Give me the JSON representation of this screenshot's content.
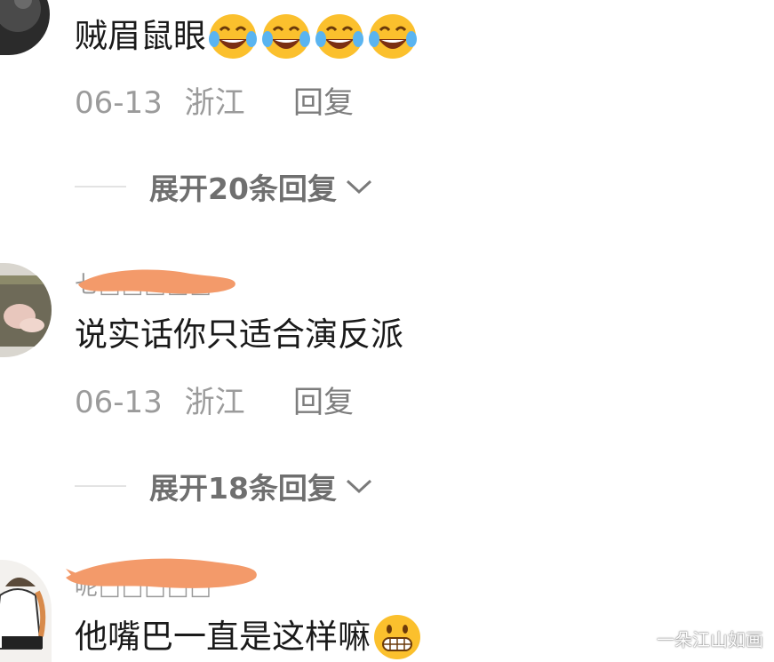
{
  "comments": [
    {
      "text": "贼眉鼠眼",
      "emojis": [
        "tears-of-joy-icon",
        "tears-of-joy-icon",
        "tears-of-joy-icon",
        "tears-of-joy-icon"
      ],
      "date": "06-13",
      "location": "浙江",
      "reply_label": "回复",
      "expand_label": "展开20条回复"
    },
    {
      "username": "七□□□□□",
      "text": "说实话你只适合演反派",
      "date": "06-13",
      "location": "浙江",
      "reply_label": "回复",
      "expand_label": "展开18条回复"
    },
    {
      "username": "呢□□□□□",
      "text": "他嘴巴一直是这样嘛",
      "emojis": [
        "grimacing-face-icon"
      ]
    }
  ],
  "watermark": "一朵江山如画",
  "colors": {
    "redaction": "#f39a6a",
    "emoji_yellow": "#fbc02d"
  }
}
